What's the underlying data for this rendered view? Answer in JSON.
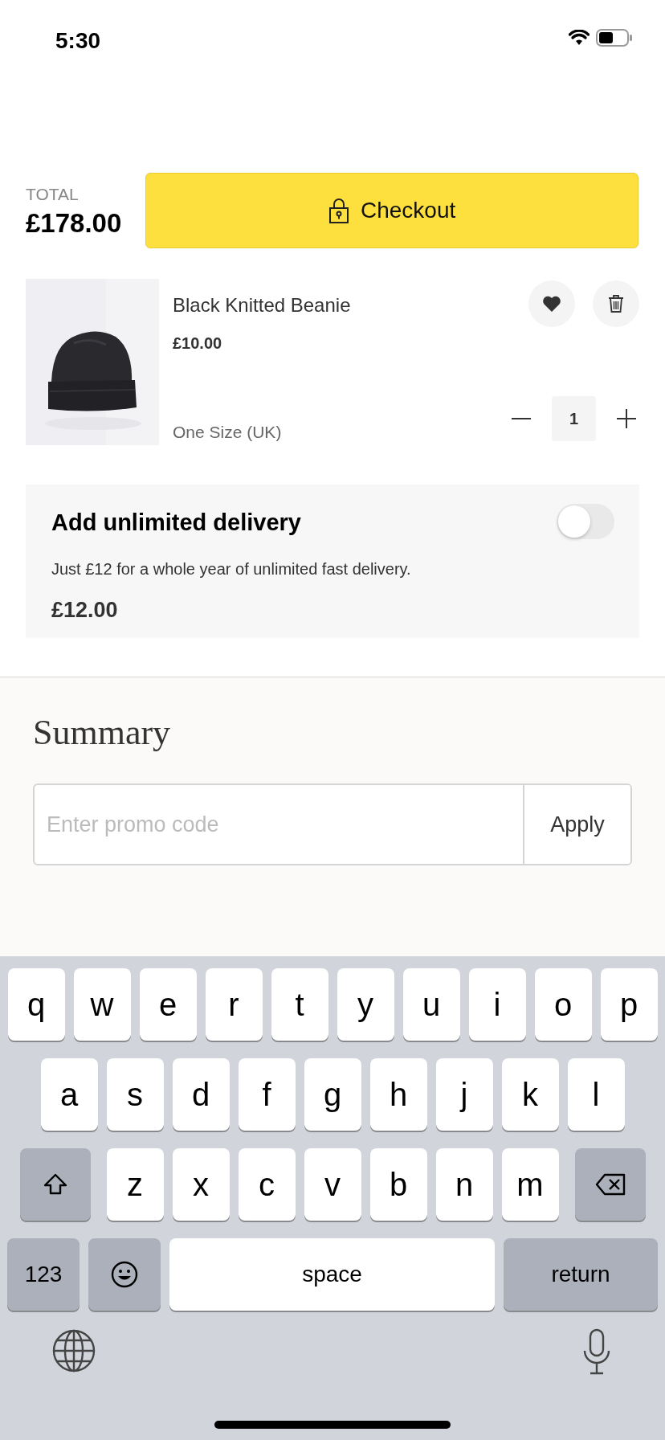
{
  "status_bar": {
    "time": "5:30"
  },
  "total": {
    "label": "TOTAL",
    "amount": "£178.00"
  },
  "checkout_button": {
    "label": "Checkout"
  },
  "cart_items": [
    {
      "name": "Black Knitted Beanie",
      "price": "£10.00",
      "size": "One Size (UK)",
      "quantity": "1",
      "favorite": true
    }
  ],
  "delivery_offer": {
    "title": "Add unlimited delivery",
    "description": "Just £12 for a whole year of unlimited fast delivery.",
    "price": "£12.00",
    "on": false
  },
  "summary": {
    "title": "Summary",
    "promo": {
      "placeholder": "Enter promo code",
      "button": "Apply"
    }
  },
  "keyboard": {
    "rows": [
      {
        "keys": [
          {
            "kind": "letter",
            "label": "q"
          },
          {
            "kind": "letter",
            "label": "w"
          },
          {
            "kind": "letter",
            "label": "e"
          },
          {
            "kind": "letter",
            "label": "r"
          },
          {
            "kind": "letter",
            "label": "t"
          },
          {
            "kind": "letter",
            "label": "y"
          },
          {
            "kind": "letter",
            "label": "u"
          },
          {
            "kind": "letter",
            "label": "i"
          },
          {
            "kind": "letter",
            "label": "o"
          },
          {
            "kind": "letter",
            "label": "p"
          }
        ]
      },
      {
        "keys": [
          {
            "kind": "letter",
            "label": "a"
          },
          {
            "kind": "letter",
            "label": "s"
          },
          {
            "kind": "letter",
            "label": "d"
          },
          {
            "kind": "letter",
            "label": "f"
          },
          {
            "kind": "letter",
            "label": "g"
          },
          {
            "kind": "letter",
            "label": "h"
          },
          {
            "kind": "letter",
            "label": "j"
          },
          {
            "kind": "letter",
            "label": "k"
          },
          {
            "kind": "letter",
            "label": "l"
          }
        ]
      },
      {
        "keys": [
          {
            "kind": "shift"
          },
          {
            "kind": "letter",
            "label": "z"
          },
          {
            "kind": "letter",
            "label": "x"
          },
          {
            "kind": "letter",
            "label": "c"
          },
          {
            "kind": "letter",
            "label": "v"
          },
          {
            "kind": "letter",
            "label": "b"
          },
          {
            "kind": "letter",
            "label": "n"
          },
          {
            "kind": "letter",
            "label": "m"
          },
          {
            "kind": "delete"
          }
        ]
      },
      {
        "keys": [
          {
            "kind": "mode",
            "label": "123"
          },
          {
            "kind": "emoji"
          },
          {
            "kind": "space",
            "label": "space"
          },
          {
            "kind": "return",
            "label": "return"
          }
        ]
      }
    ]
  }
}
